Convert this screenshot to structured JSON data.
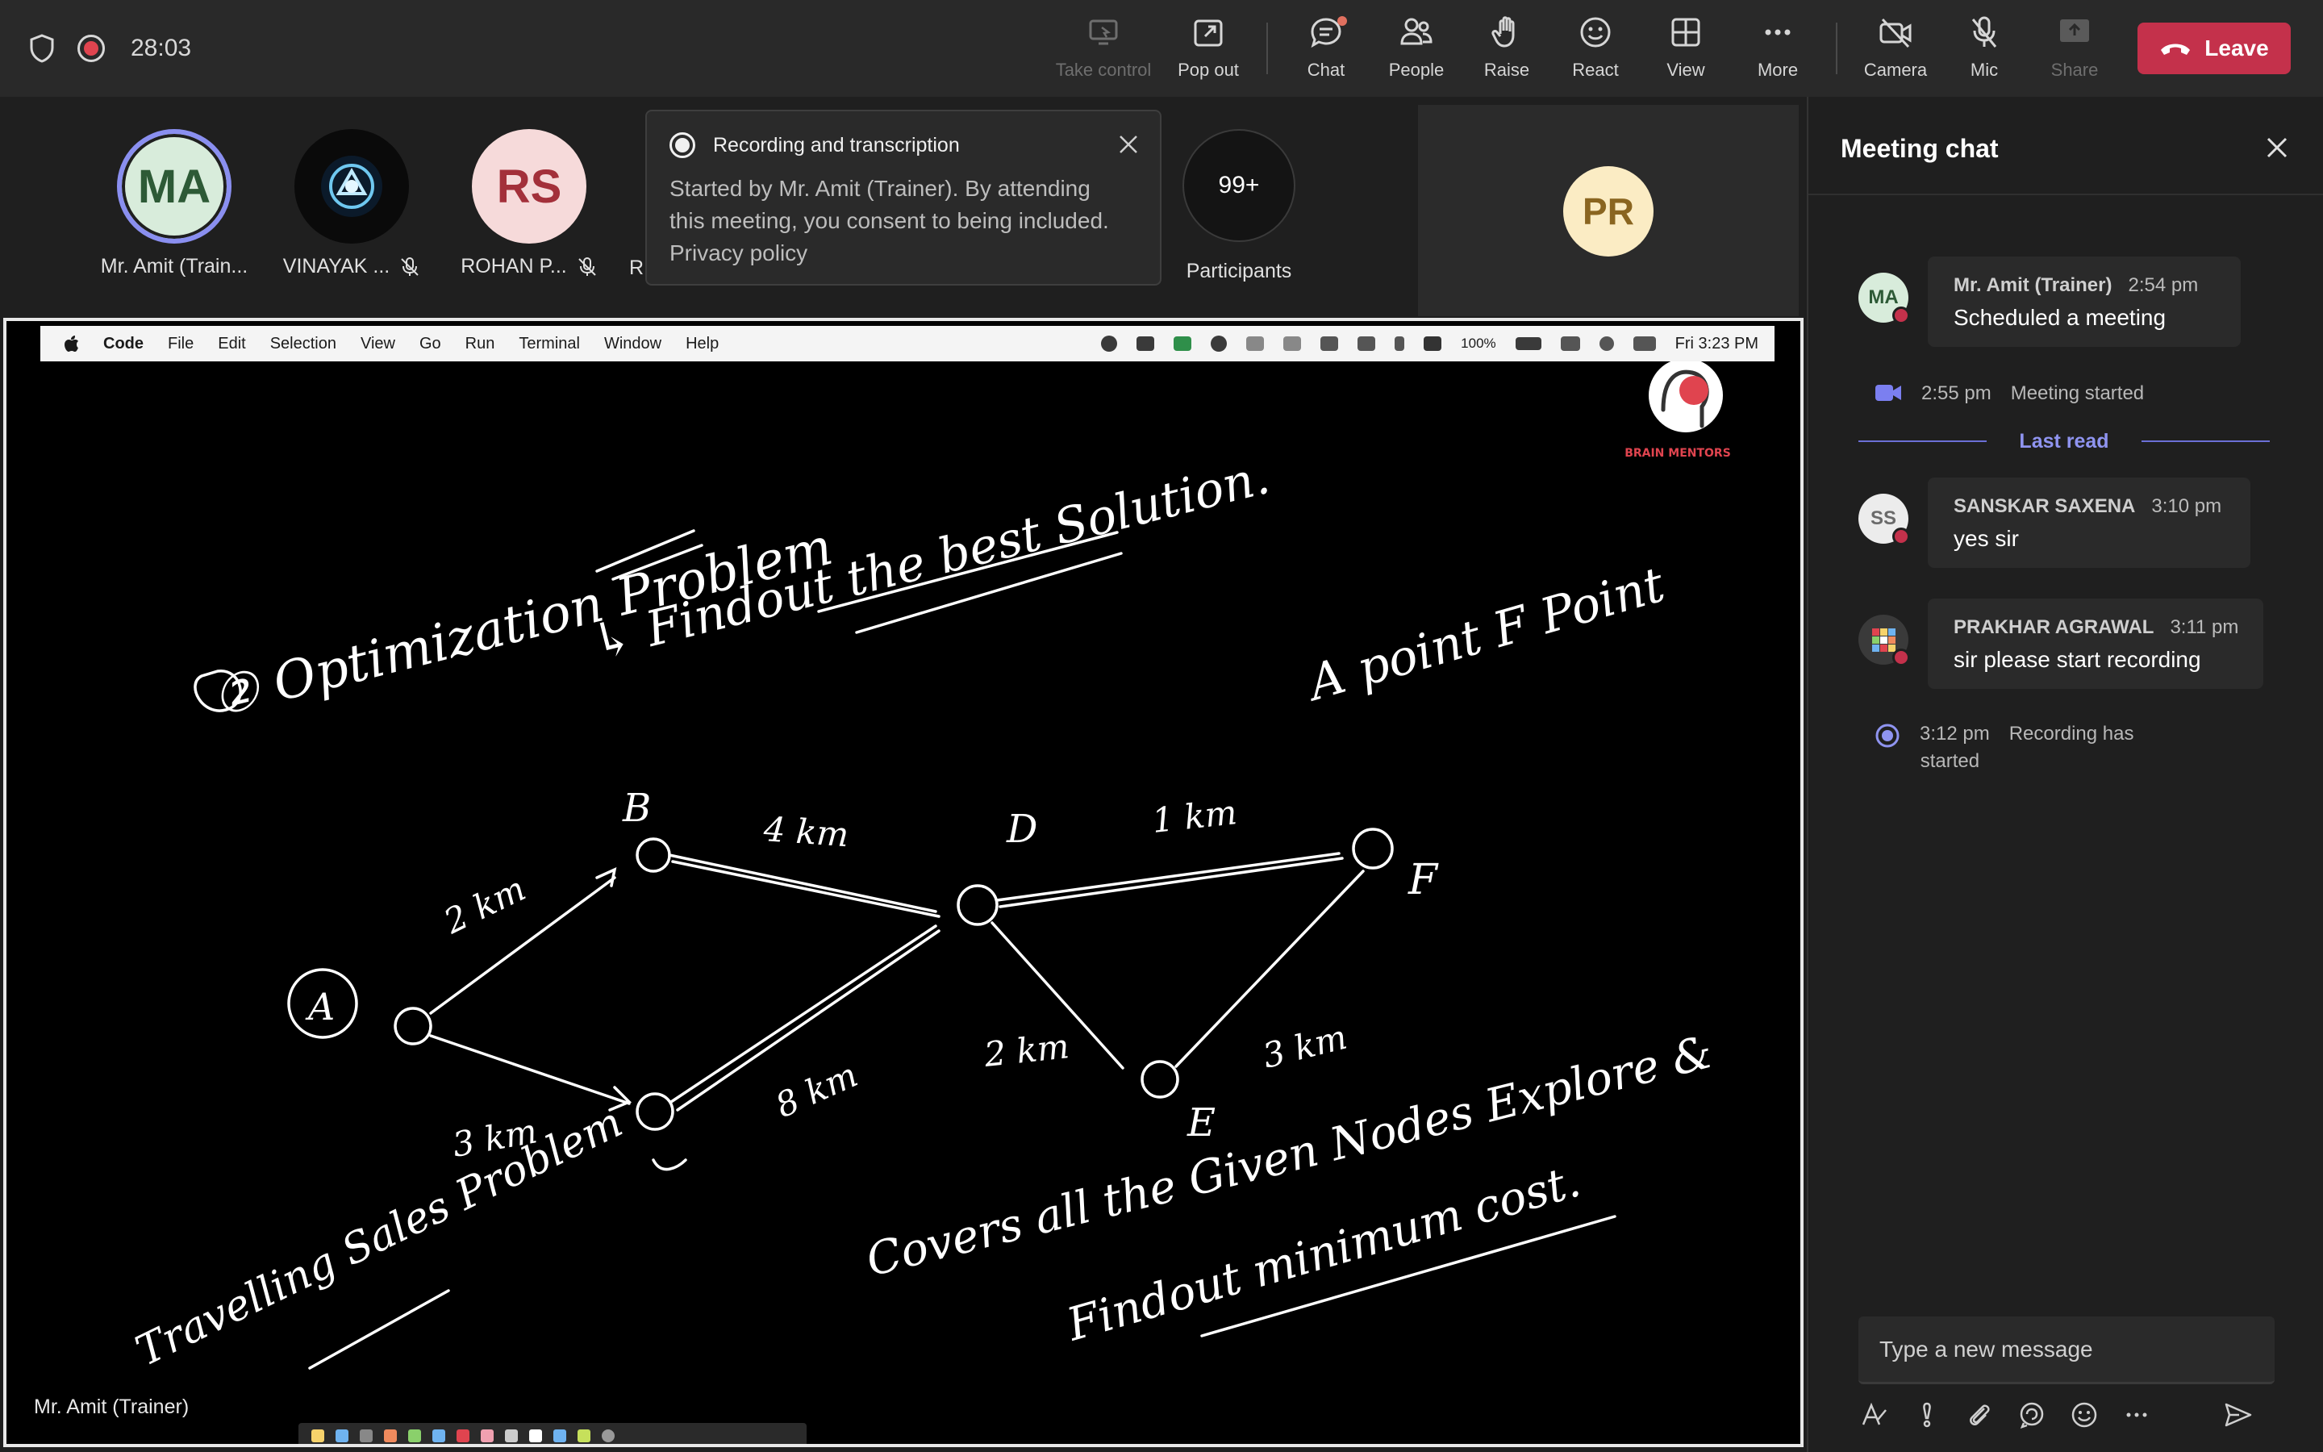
{
  "topbar": {
    "timer": "28:03",
    "buttons": {
      "take_control": "Take control",
      "pop_out": "Pop out",
      "chat": "Chat",
      "people": "People",
      "raise": "Raise",
      "react": "React",
      "view": "View",
      "more": "More",
      "camera": "Camera",
      "mic": "Mic",
      "share": "Share"
    },
    "leave": "Leave"
  },
  "participants": {
    "items": [
      {
        "initials": "MA",
        "name": "Mr. Amit (Train..."
      },
      {
        "initials": "",
        "name": "VINAYAK ..."
      },
      {
        "initials": "RS",
        "name": "ROHAN P..."
      },
      {
        "initials": "",
        "name": "R"
      }
    ],
    "more_count": "99+",
    "more_label": "Participants",
    "tile_initials": "PR"
  },
  "notice": {
    "title": "Recording and transcription",
    "line1": "Started by Mr. Amit (Trainer). By attending",
    "line2": "this meeting, you consent to being included.",
    "link": "Privacy policy"
  },
  "screen": {
    "menubar": {
      "items": [
        "Code",
        "File",
        "Edit",
        "Selection",
        "View",
        "Go",
        "Run",
        "Terminal",
        "Window",
        "Help"
      ],
      "battery": "100%",
      "clock": "Fri 3:23 PM"
    },
    "logo_text": "BRAIN MENTORS",
    "presenter": "Mr. Amit (Trainer)",
    "board": {
      "heading": "② Optimization Problem",
      "sub": "↳ Findout the best Solution.",
      "goal": "A point F Point",
      "nodes": [
        "A",
        "B",
        "C",
        "D",
        "E",
        "F"
      ],
      "edges": [
        "2 km",
        "4 km",
        "1 km",
        "3 km",
        "8 km",
        "2 km",
        "3 km"
      ],
      "note1": "Travelling Sales Problem",
      "note2": "Covers all the Given Nodes Explore &",
      "note3": "Findout minimum cost."
    }
  },
  "chat": {
    "title": "Meeting chat",
    "messages": [
      {
        "initials": "MA",
        "who": "Mr. Amit (Trainer)",
        "time": "2:54 pm",
        "text": "Scheduled a meeting"
      },
      {
        "initials": "SS",
        "who": "SANSKAR SAXENA",
        "time": "3:10 pm",
        "text": "yes sir"
      },
      {
        "initials": "",
        "who": "PRAKHAR AGRAWAL",
        "time": "3:11 pm",
        "text": "sir please start recording"
      }
    ],
    "events": [
      {
        "time": "2:55 pm",
        "text": "Meeting started"
      },
      {
        "time": "3:12 pm",
        "text1": "Recording has",
        "text2": "started"
      }
    ],
    "last_read": "Last read",
    "compose_placeholder": "Type a new message"
  },
  "colors": {
    "leave": "#c4314b",
    "accent": "#8f94f0",
    "toolbar": "#292929"
  }
}
